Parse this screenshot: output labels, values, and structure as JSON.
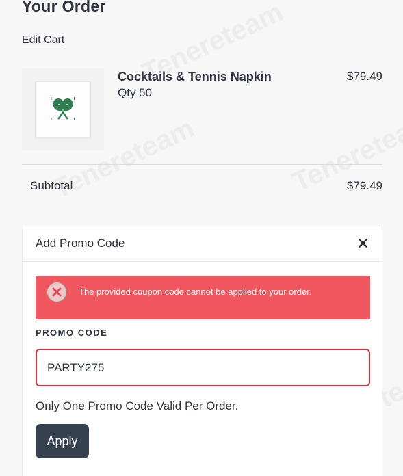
{
  "page": {
    "title": "Your Order",
    "edit_cart_label": "Edit Cart"
  },
  "cart_item": {
    "name": "Cocktails & Tennis Napkin",
    "qty_label": "Qty 50",
    "price": "$79.49",
    "thumbnail_icon": "tennis-racket-napkin-icon"
  },
  "summary": {
    "subtotal_label": "Subtotal",
    "subtotal_value": "$79.49"
  },
  "promo": {
    "title": "Add Promo Code",
    "close_icon": "close-icon",
    "error_message": "The provided coupon code cannot be applied to your order.",
    "field_label": "PROMO CODE",
    "field_value": "PARTY275",
    "note": "Only One Promo Code Valid Per Order.",
    "apply_label": "Apply"
  },
  "watermark_text": "Tenereteam",
  "colors": {
    "text": "#2e3340",
    "error_bg": "#f0575f",
    "error_border": "#d9313b",
    "button_bg": "#36414f",
    "napkin_green": "#2e7d4f"
  }
}
